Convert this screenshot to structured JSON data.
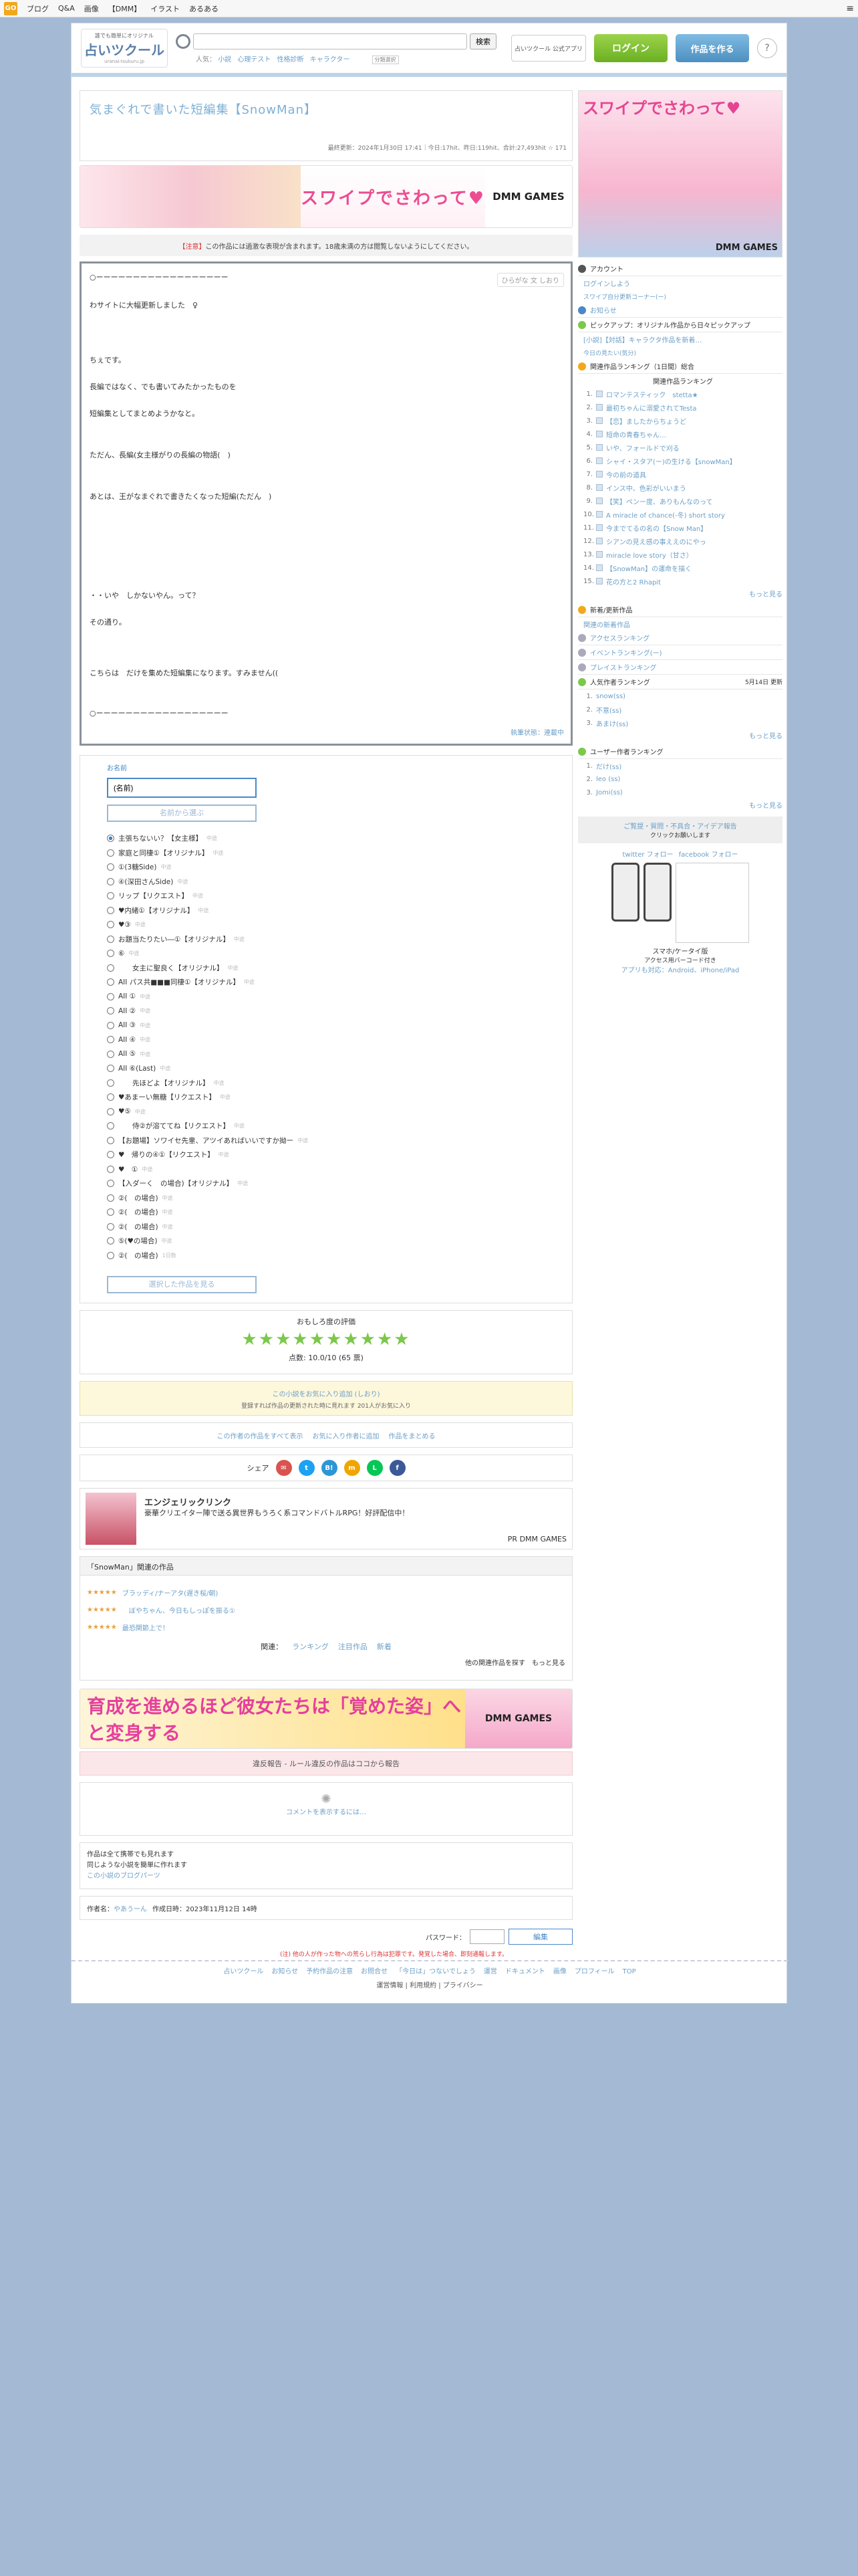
{
  "topbar": {
    "logo": "GO",
    "links": [
      "ブログ",
      "Q&A",
      "画像",
      "【DMM】",
      "イラスト",
      "あるある"
    ]
  },
  "header": {
    "brand_tag": "誰でも簡単にオリジナル",
    "brand_name": "占いツクール",
    "brand_sub": "uranai-tsukuru.jp",
    "search_placeholder": "",
    "search_button": "検索",
    "search_option": "分類選択",
    "hint_label": "人気：",
    "hints": [
      "小説",
      "心理テスト",
      "性格診断",
      "キャラクター"
    ],
    "app_button": "占いツクール 公式アプリ",
    "login": "ログイン",
    "make": "作品を作る",
    "help": "?"
  },
  "work": {
    "title": "気まぐれで書いた短編集【SnowMan】",
    "meta": "最終更新：2024年1月30日 17:41｜今日:17hit、昨日:119hit、合計:27,493hit ☆ 171",
    "notice_red": "【注意】",
    "notice": "この作品には過激な表現が含まれます。18歳未満の方は閲覧しないようにしてください。",
    "tools": "ひらがな 文 しおり",
    "lines": [
      "○ーーーーーーーーーーーーーーーーーー",
      "わサイトに大幅更新しました　♀",
      "ちぇです。",
      "長編ではなく、でも書いてみたかったものを",
      "短編集としてまとめようかなと。",
      "ただん、長編(女主様がりの長編の物語(　)",
      "あとは、王がなまぐれで書きたくなった短編(ただん　)",
      "・・いや　しかないやん。って？",
      "その通り。",
      "こちらは　だけを集めた短編集になります。すみません((",
      "○ーーーーーーーーーーーーーーーーーー"
    ],
    "footer_link": "執筆状態：連載中"
  },
  "poll": {
    "name_label": "お名前",
    "name_value": "(名前)",
    "name_button": "名前から選ぶ",
    "options": [
      "主張ちないい？【女主様】",
      "家庭と同棲①【オリジナル】",
      "①(3糖Side)",
      "④(深田さんSide)",
      "リップ【リクエスト】",
      "♥内緒①【オリジナル】",
      "♥③",
      "お題当たりたい―①【オリジナル】",
      "⑥",
      "　　女主に聖良く【オリジナル】",
      "AII パス共■■■同棲①【オリジナル】",
      "AII ①",
      "AII ②",
      "AII ③",
      "AII ④",
      "AII ⑤",
      "AII ⑥(Last)",
      "　　先ほどよ【オリジナル】",
      "♥あまーい無糖【リクエスト】",
      "♥⑤",
      "　　侍②が溶ててね【リクエスト】",
      "【お題場】ソワイセ先輩、アツイあればいいですか拗ー",
      "♥　帰りの④①【リクエスト】",
      "♥　①",
      "【入ダーく　の場合)【オリジナル】",
      "②(　の場合)",
      "②(　の場合)",
      "②(　の場合)",
      "⑤(♥の場合)",
      "②(　の場合)"
    ],
    "vote_tag": "中途",
    "last_note": "1日数",
    "bottom_button": "選択した作品を見る"
  },
  "rating": {
    "label": "おもしろ度の評価",
    "value": 10,
    "max": 10,
    "votes": 65,
    "score_text": "点数: 10.0/10 (65 票)"
  },
  "fav": {
    "main": "この小説をお気に入り追加 (しおり)",
    "sub": "登録すれば作品の更新された時に見れます 201人がお気に入り"
  },
  "links": [
    "この作者の作品をすべて表示",
    "お気に入り作者に追加",
    "作品をまとめる"
  ],
  "share": {
    "label": "シェア"
  },
  "ad": {
    "title": "エンジェリックリンク",
    "desc": "豪華クリエイター陣で送る異世界もうろく系コマンドバトルRPG！好評配信中！",
    "pr": "PR DMM GAMES"
  },
  "related": {
    "header": "「SnowMan」関連の作品",
    "items": [
      "ブラッディ/ナーアタ(遅き桜/朝)",
      "　ぼやちゃん、今日もしっぽを振る①",
      "最恐関節上で！"
    ],
    "rank_label": "関連：",
    "rank_links": [
      "ランキング",
      "注目作品",
      "新着"
    ],
    "more": "他の関連作品を探す　もっと見る"
  },
  "banner2": {
    "text": "育成を進めるほど彼女たちは「覚めた姿」へと変身する",
    "brand": "DMM GAMES"
  },
  "pinkbar": "違反報告 - ルール違反の作品はココから報告",
  "comment": "コメントを表示するには…",
  "mobile": [
    "作品は全て携帯でも見れます",
    "同じような小説を簡単に作れます",
    "この小説のブログパーツ"
  ],
  "author": {
    "label": "作者名：",
    "name": "やあうーん",
    "date_label": "作成日時：",
    "date": "2023年11月12日 14時"
  },
  "pass": {
    "label": "パスワード：",
    "button": "編集",
    "warn": "(注) 他の人が作った物への荒らし行為は犯罪です。発覚した場合、即刻通報します。"
  },
  "footer": {
    "links": [
      "占いツクール",
      "お知らせ",
      "予約作品の注意",
      "お問合せ",
      "「今日は」つないでしょう",
      "運営",
      "ドキュメント",
      "画像",
      "プロフィール",
      "TOP"
    ],
    "sub": "運営情報 | 利用規約 | プライバシー"
  },
  "sidebar": {
    "banner_title": "スワイプでさわって♥",
    "banner_brand": "DMM GAMES",
    "account": "アカウント",
    "login_link": "ログインしよう",
    "login_sub": "スワイプ自分更新コーナー(ー)",
    "notice": "お知らせ",
    "pickup": "ピックアップ：オリジナル作品から日々ピックアップ",
    "pickup_item": "[小説]【対話】キャラクタ作品を新着…",
    "week": "今日の見たい(気分)",
    "rank_title": "関連作品ランキング（1日間）総合",
    "rank_sub": "関連作品ランキング",
    "rank_items": [
      "ロマンテスティック　stetta★",
      "最初ちゃんに溺愛されてTesta",
      "【恋】ましたからちょうど",
      "短命の青春ちゃん…",
      "いや、フォールドで刈る",
      "シャイ・スタア(ー)の生ける【snowMan】",
      "今の前の道具",
      "インス中、色彩がいいまう",
      "【笑】ペンー度、ありもんなのって",
      "A miracle of chance(-冬) short story",
      "今までてるの名の【Snow Man】",
      "シアンの見え感の事ええのにやっ",
      "miracle love story（甘さ）",
      "【SnowMan】の運命を描く",
      "花の方と2 Rhapit"
    ],
    "more": "もっと見る",
    "ranking2": "新着/更新作品",
    "new_link": "関連の新着作品",
    "other": [
      "アクセスランキング",
      "イベントランキング(ー)",
      "プレイストランキング"
    ],
    "hist": "人気作者ランキング",
    "hist_date": "5月14日 更新",
    "hist_items": [
      "snow(ss) ",
      "不意(ss) ",
      "あまけ(ss) "
    ],
    "fav": "ユーザー作者ランキング",
    "fav_items": [
      "だけ(ss)",
      "leo (ss)",
      "Jomi(ss)"
    ],
    "req": "ご覧提・質問・不具合・アイデア報告",
    "req_sub": "クリックお願いします",
    "twitter": "twitter フォロー",
    "facebook": "facebook フォロー",
    "mobile_title": "スマホ/ケータイ版",
    "mobile_sub": "アクセス用バーコード付き",
    "app": "アプリも対応：Android、iPhone/iPad"
  }
}
